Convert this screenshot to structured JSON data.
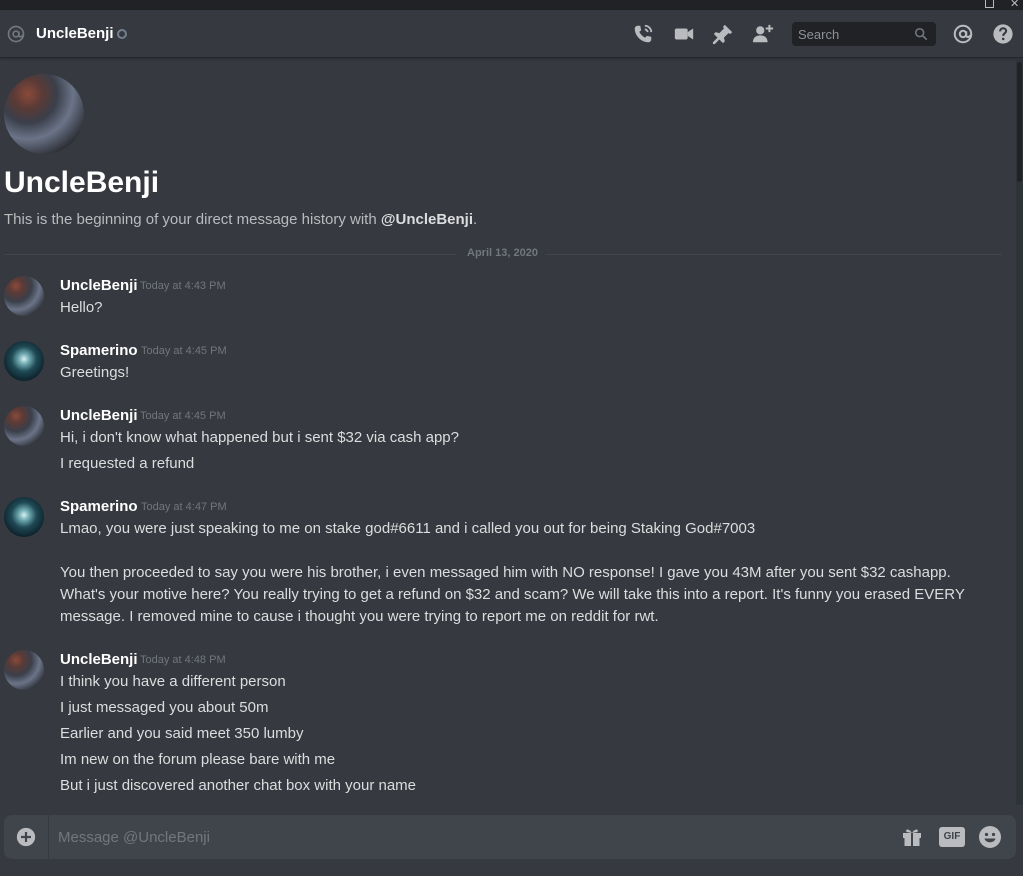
{
  "header": {
    "title": "UncleBenji",
    "search_placeholder": "Search"
  },
  "intro": {
    "name": "UncleBenji",
    "text_prefix": "This is the beginning of your direct message history with ",
    "text_user": "@UncleBenji",
    "text_suffix": "."
  },
  "date_divider": "April 13, 2020",
  "messages": [
    {
      "author": "UncleBenji",
      "time": "Today at 4:43 PM",
      "lines": [
        "Hello?"
      ]
    },
    {
      "author": "Spamerino",
      "time": "Today at 4:45 PM",
      "lines": [
        "Greetings!"
      ]
    },
    {
      "author": "UncleBenji",
      "time": "Today at 4:45 PM",
      "lines": [
        "Hi, i don't know what happened but i sent $32 via cash app?",
        "I requested a refund"
      ]
    },
    {
      "author": "Spamerino",
      "time": "Today at 4:47 PM",
      "lines": [
        "Lmao, you were just speaking to me on stake god#6611 and i called you out for being Staking God#7003",
        "You then proceeded to say you were his brother, i even messaged him with NO response! I gave you 43M after you sent $32 cashapp.",
        "What's your motive here? You really trying to get a refund on $32 and scam? We will take this into a report. It's funny you erased EVERY",
        "message. I removed mine to cause i thought you were trying to report me on reddit for rwt."
      ]
    },
    {
      "author": "UncleBenji",
      "time": "Today at 4:48 PM",
      "lines": [
        "I think you have a different person",
        "I just messaged you about 50m",
        "Earlier and you said meet 350 lumby",
        "Im new on the forum please bare with me",
        "But i just discovered another chat box with your name"
      ]
    }
  ],
  "composer": {
    "placeholder": "Message @UncleBenji",
    "gif_label": "GIF"
  },
  "colors": {
    "background": "#36393f",
    "header_text": "#ffffff",
    "muted": "#72767d",
    "input_bg": "#40444b"
  }
}
